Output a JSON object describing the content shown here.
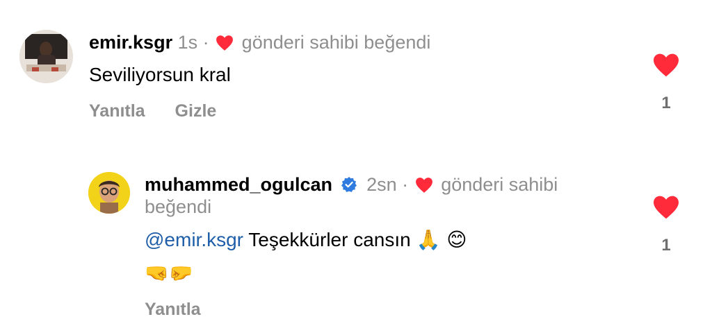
{
  "comments": [
    {
      "username": "emir.ksgr",
      "time": "1s",
      "dot": "·",
      "owner_liked": "gönderi sahibi beğendi",
      "text": "Seviliyorsun kral",
      "actions": {
        "reply": "Yanıtla",
        "hide": "Gizle"
      },
      "like_count": "1"
    },
    {
      "username": "muhammed_ogulcan",
      "verified": true,
      "time": "2sn",
      "dot": "·",
      "owner_liked_line1": "gönderi sahibi",
      "owner_liked_line2": "beğendi",
      "mention": "@emir.ksgr",
      "text": "Teşekkürler cansın",
      "text_emojis": "🙏 😊",
      "emoji_line": "🤜🤛",
      "actions": {
        "reply": "Yanıtla"
      },
      "like_count": "1"
    }
  ],
  "colors": {
    "heart": "#ff2a3a",
    "meta_text": "#8e8e8e",
    "mention": "#1f5ea8",
    "verified": "#2f7be0"
  },
  "icons": [
    "heart-icon",
    "verified-badge-icon"
  ]
}
